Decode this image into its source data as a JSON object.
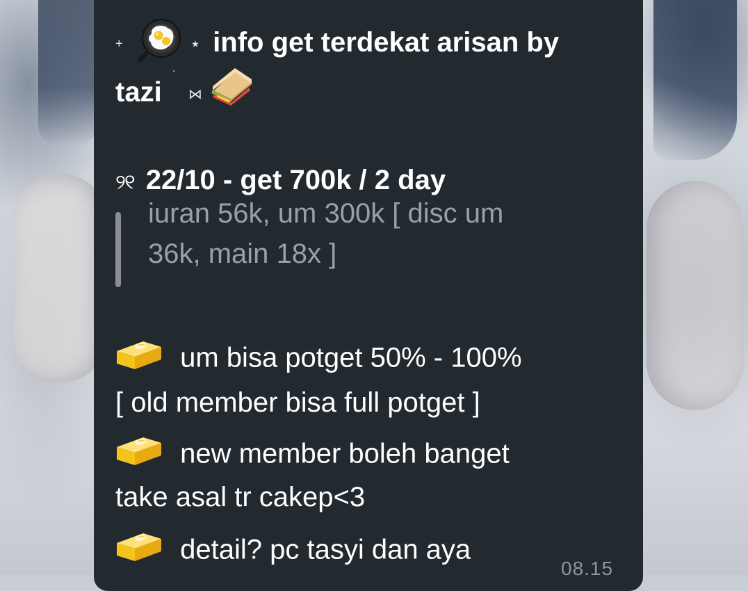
{
  "message": {
    "title_line1": "info get terdekat arisan by",
    "title_line2": "tazi",
    "title_prefix_symbol": "+",
    "title_star_symbol": "⋆",
    "title_suffix_symbol": "⋈",
    "title_dot_symbol": "˙",
    "date_symbol": "୨୧",
    "headline": "22/10 - get 700k / 2 day",
    "quote_line1": "iuran 56k, um 300k [ disc um",
    "quote_line2": "36k, main 18x ]",
    "bullet1": "um bisa potget 50% - 100%",
    "bullet1_cont": "[ old member bisa full potget ]",
    "bullet2": "new member boleh banget",
    "bullet2_cont": "take asal tr cakep<3",
    "bullet3": "detail? pc tasyi dan aya",
    "timestamp": "08.15"
  },
  "icons": {
    "title_icon": "fried-egg-pan-icon",
    "title_end_icon": "sandwich-icon",
    "bullet_icon": "butter-icon"
  },
  "colors": {
    "bubble_background": "#222a30",
    "text_primary": "#ffffff",
    "quote_text": "#9aa0a6",
    "quote_bar": "#8b8f94",
    "timestamp": "#8f959b"
  }
}
